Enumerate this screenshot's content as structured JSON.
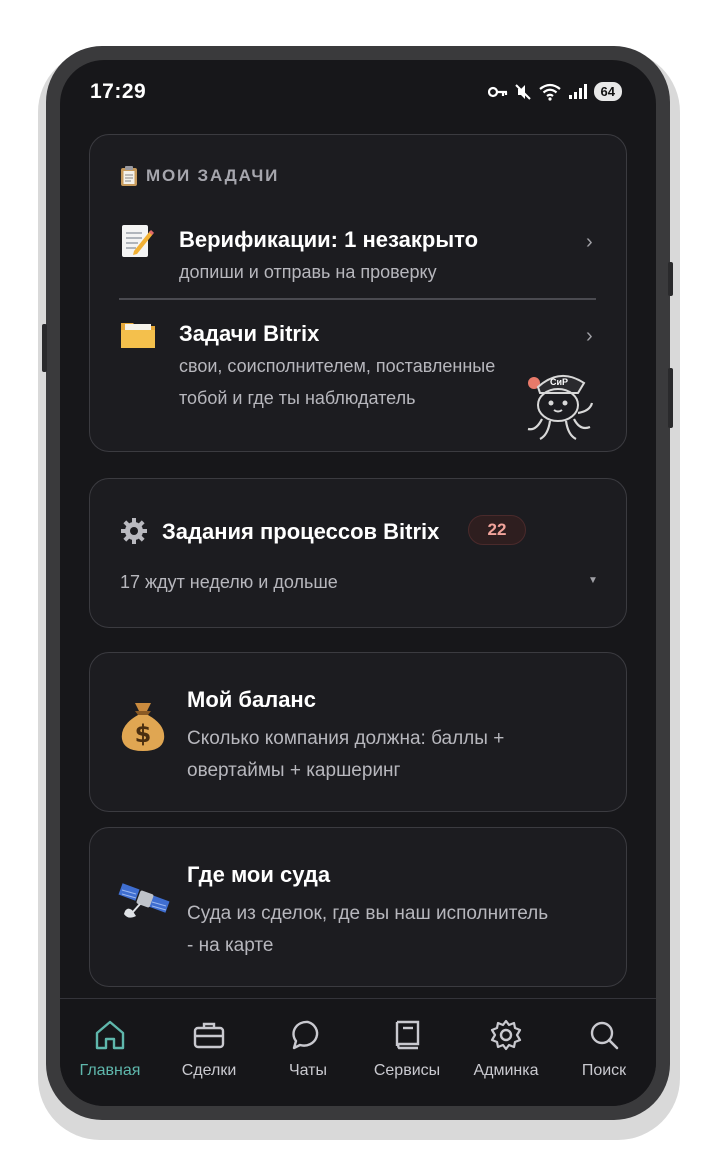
{
  "status_bar": {
    "time": "17:29",
    "battery": "64"
  },
  "my_tasks": {
    "section_label": "МОИ ЗАДАЧИ",
    "items": [
      {
        "title": "Верификации: 1 незакрыто",
        "subtitle": "допиши и отправь на проверку",
        "icon": "memo-icon"
      },
      {
        "title": "Задачи Bitrix",
        "subtitle_line1": "свои, соисполнителем, поставленные",
        "subtitle_line2": "тобой и где ты наблюдатель",
        "icon": "folder-icon"
      }
    ],
    "mascot_label": "СиР"
  },
  "process_tasks": {
    "title": "Задания процессов Bitrix",
    "count": "22",
    "subtitle": "17 ждут неделю и дольше",
    "icon": "gear-icon"
  },
  "balance": {
    "title": "Мой баланс",
    "subtitle_line1": "Сколько компания должна: баллы +",
    "subtitle_line2": "овертаймы + каршеринг",
    "icon": "money-bag-icon"
  },
  "ships": {
    "title": "Где мои суда",
    "subtitle_line1": "Суда из сделок, где вы наш исполнитель",
    "subtitle_line2": "- на карте",
    "icon": "satellite-icon"
  },
  "tabbar": {
    "tabs": [
      {
        "label": "Главная",
        "icon": "home-icon",
        "active": true
      },
      {
        "label": "Сделки",
        "icon": "briefcase-icon",
        "active": false
      },
      {
        "label": "Чаты",
        "icon": "chat-icon",
        "active": false
      },
      {
        "label": "Сервисы",
        "icon": "book-icon",
        "active": false
      },
      {
        "label": "Админка",
        "icon": "gear-icon",
        "active": false
      },
      {
        "label": "Поиск",
        "icon": "search-icon",
        "active": false
      }
    ]
  },
  "colors": {
    "accent": "#5fb7ac",
    "background": "#17171a",
    "card": "#1c1c20",
    "badge_text": "#f1a39b"
  }
}
